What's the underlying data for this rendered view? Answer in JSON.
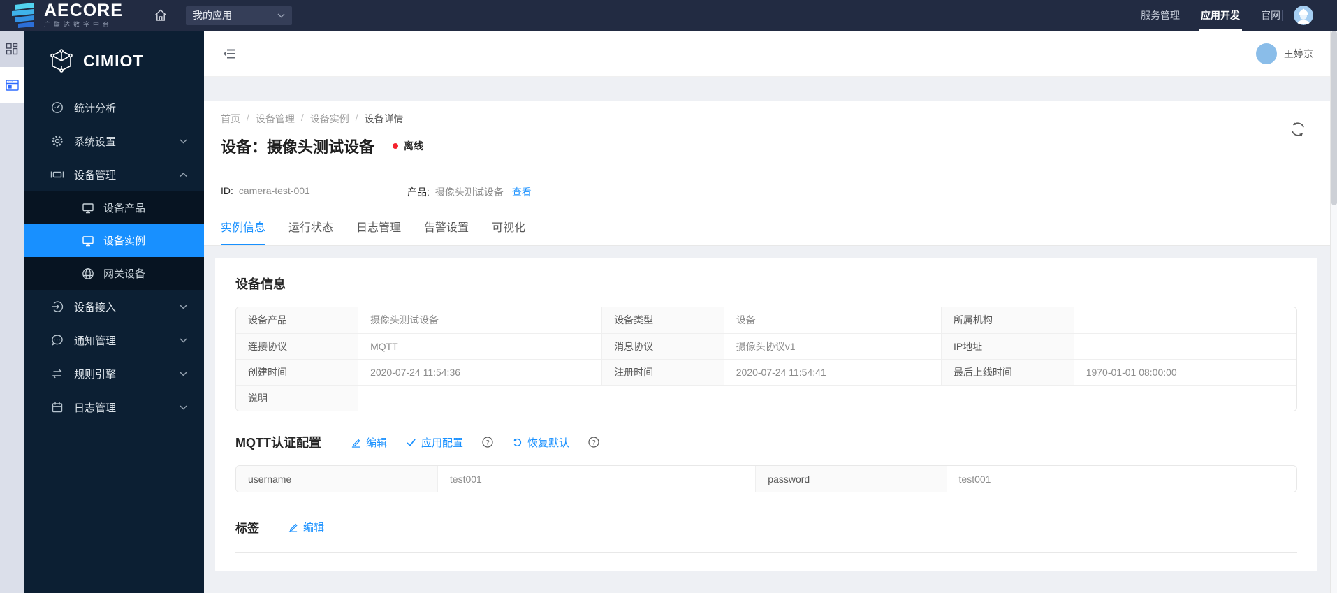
{
  "colors": {
    "accent": "#1890ff",
    "topbar_bg": "#222b42",
    "sidebar_bg": "#0c1f33",
    "submenu_bg": "#071422",
    "status_offline": "#f5222d",
    "page_bg": "#eef0f4"
  },
  "topbar": {
    "brand_name": "AECORE",
    "brand_subtitle": "广联达数字中台",
    "app_select_value": "我的应用",
    "menu": [
      {
        "label": "服务管理",
        "active": false
      },
      {
        "label": "应用开发",
        "active": true
      },
      {
        "label": "官网",
        "active": false
      }
    ],
    "icons": [
      {
        "name": "brand-mark-icon"
      },
      {
        "name": "home-icon"
      },
      {
        "name": "chevron-down-icon"
      },
      {
        "name": "helmet-avatar-icon"
      }
    ]
  },
  "rail": {
    "icons": [
      {
        "name": "apps-grid-icon"
      },
      {
        "name": "app-window-icon",
        "active": true
      }
    ]
  },
  "sidebar": {
    "logo_text": "CIMIOT",
    "logo_icon": "cube-wireframe-icon",
    "items": [
      {
        "label": "统计分析",
        "icon": "dashboard-icon",
        "chevron": "none"
      },
      {
        "label": "系统设置",
        "icon": "gear-icon",
        "chevron": "down"
      },
      {
        "label": "设备管理",
        "icon": "device-icon",
        "chevron": "up",
        "expanded": true
      },
      {
        "label": "设备接入",
        "icon": "access-icon",
        "chevron": "down"
      },
      {
        "label": "通知管理",
        "icon": "message-icon",
        "chevron": "down"
      },
      {
        "label": "规则引擎",
        "icon": "rules-icon",
        "chevron": "down"
      },
      {
        "label": "日志管理",
        "icon": "calendar-icon",
        "chevron": "down"
      }
    ],
    "device_submenu": [
      {
        "label": "设备产品",
        "icon": "monitor-icon",
        "active": false
      },
      {
        "label": "设备实例",
        "icon": "monitor-icon",
        "active": true
      },
      {
        "label": "网关设备",
        "icon": "globe-icon",
        "active": false
      }
    ]
  },
  "header": {
    "user_name": "王婷京"
  },
  "page": {
    "breadcrumb": [
      "首页",
      "设备管理",
      "设备实例",
      "设备详情"
    ],
    "title": "设备：摄像头测试设备",
    "status_label": "离线",
    "id_label": "ID:",
    "id_value": "camera-test-001",
    "product_label": "产品:",
    "product_value": "摄像头测试设备",
    "product_link": "查看",
    "tabs": [
      {
        "label": "实例信息",
        "active": true
      },
      {
        "label": "运行状态",
        "active": false
      },
      {
        "label": "日志管理",
        "active": false
      },
      {
        "label": "告警设置",
        "active": false
      },
      {
        "label": "可视化",
        "active": false
      }
    ]
  },
  "device_info": {
    "heading": "设备信息",
    "rows": [
      {
        "c0": "设备产品",
        "c1": "摄像头测试设备",
        "c2": "设备类型",
        "c3": "设备",
        "c4": "所属机构",
        "c5": ""
      },
      {
        "c0": "连接协议",
        "c1": "MQTT",
        "c2": "消息协议",
        "c3": "摄像头协议v1",
        "c4": "IP地址",
        "c5": ""
      },
      {
        "c0": "创建时间",
        "c1": "2020-07-24 11:54:36",
        "c2": "注册时间",
        "c3": "2020-07-24 11:54:41",
        "c4": "最后上线时间",
        "c5": "1970-01-01 08:00:00"
      }
    ],
    "note_label": "说明",
    "note_value": ""
  },
  "mqtt": {
    "heading": "MQTT认证配置",
    "edit_label": "编辑",
    "apply_label": "应用配置",
    "restore_label": "恢复默认",
    "row": {
      "l1": "username",
      "v1": "test001",
      "l2": "password",
      "v2": "test001"
    }
  },
  "tags": {
    "heading": "标签",
    "edit_label": "编辑"
  }
}
